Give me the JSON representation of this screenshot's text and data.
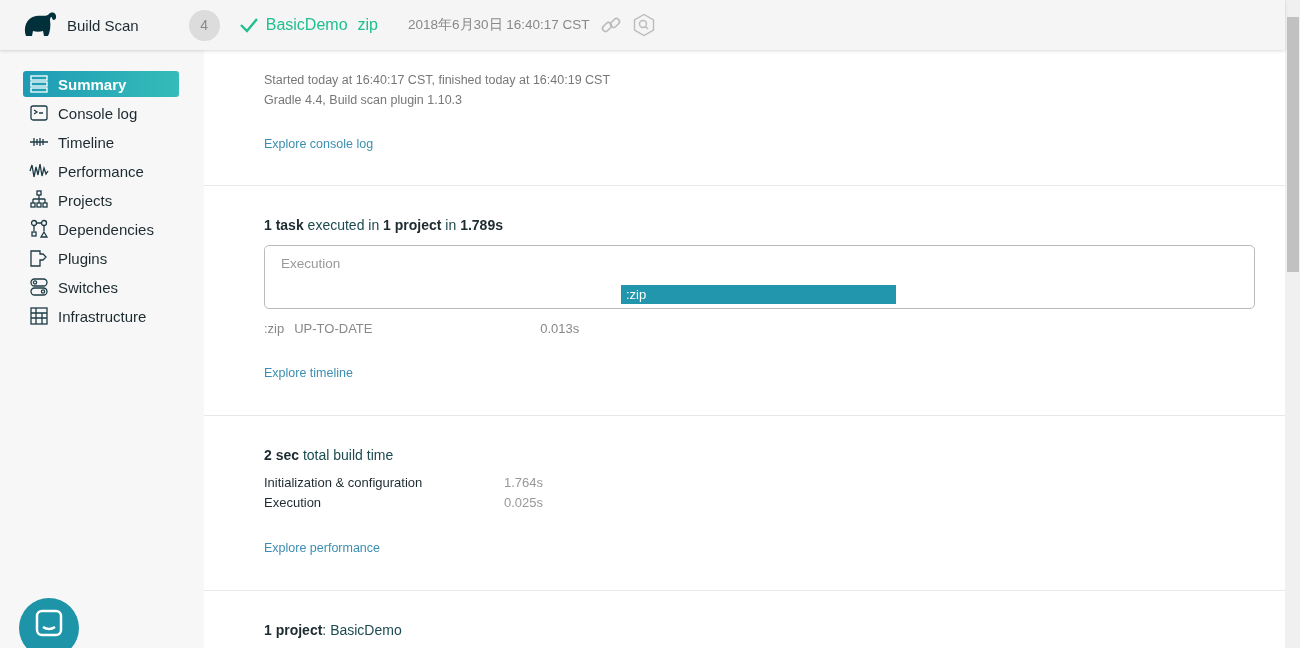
{
  "header": {
    "app_title": "Build Scan",
    "build_number": "4",
    "succeeded": true,
    "project": "BasicDemo",
    "task": "zip",
    "date": "2018年6月30日 16:40:17 CST"
  },
  "sidebar": {
    "items": [
      {
        "label": "Summary",
        "selected": true
      },
      {
        "label": "Console log",
        "selected": false
      },
      {
        "label": "Timeline",
        "selected": false
      },
      {
        "label": "Performance",
        "selected": false
      },
      {
        "label": "Projects",
        "selected": false
      },
      {
        "label": "Dependencies",
        "selected": false
      },
      {
        "label": "Plugins",
        "selected": false
      },
      {
        "label": "Switches",
        "selected": false
      },
      {
        "label": "Infrastructure",
        "selected": false
      }
    ]
  },
  "overview": {
    "lines": [
      "Started today at 16:40:17 CST, finished today at 16:40:19 CST",
      "Gradle 4.4,  Build scan plugin 1.10.3"
    ],
    "link": "Explore console log"
  },
  "tasks": {
    "heading": "**1 task** executed in **1 project** in **1.789s**",
    "timeline_label": "Execution",
    "bar": {
      "label": ":zip",
      "level": 0.52
    },
    "task_name": ":zip",
    "outcome": "UP-TO-DATE",
    "duration": "0.013s",
    "link": "Explore timeline"
  },
  "build_time": {
    "heading": "**2 sec** total build time",
    "rows": [
      {
        "label": "Initialization & configuration",
        "value": "1.764s"
      },
      {
        "label": "Execution",
        "value": "0.025s"
      }
    ],
    "link": "Explore performance"
  },
  "projects": {
    "heading": "**1 project**: BasicDemo"
  }
}
